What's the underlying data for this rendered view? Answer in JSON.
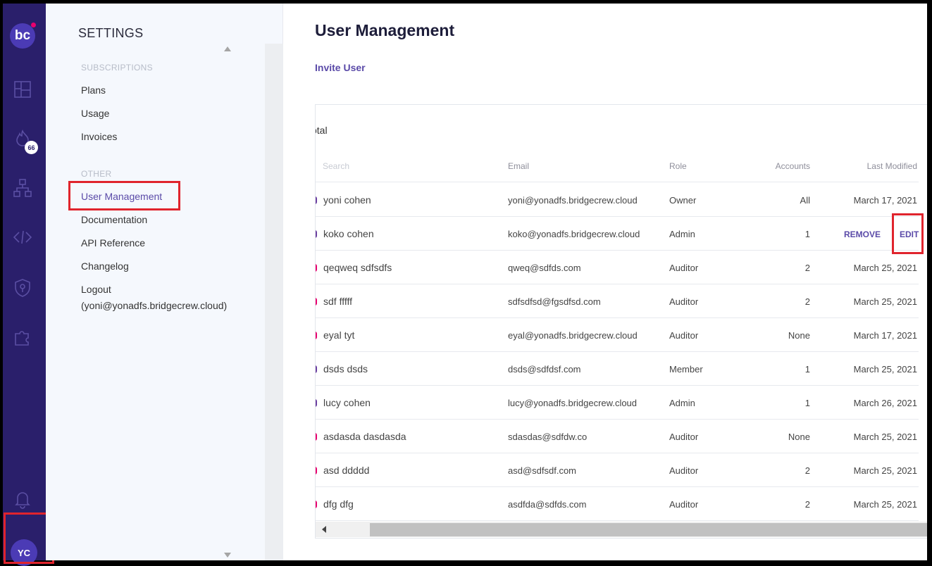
{
  "rail": {
    "logo_text": "bc",
    "badge_count": "66",
    "avatar_initials": "YC",
    "icons": [
      "dashboard-icon",
      "incidents-icon",
      "resources-icon",
      "code-icon",
      "security-icon",
      "integrations-icon",
      "bell-icon"
    ]
  },
  "settings": {
    "title": "SETTINGS",
    "subscriptions_heading": "SUBSCRIPTIONS",
    "plans": "Plans",
    "usage": "Usage",
    "invoices": "Invoices",
    "other_heading": "OTHER",
    "user_management": "User Management",
    "documentation": "Documentation",
    "api_reference": "API Reference",
    "changelog": "Changelog",
    "logout": "Logout",
    "logout_email": "(yoni@yonadfs.bridgecrew.cloud)"
  },
  "main": {
    "title": "User Management",
    "invite_label": "Invite User",
    "total_label": "otal",
    "search_placeholder": "Search",
    "columns": {
      "email": "Email",
      "role": "Role",
      "accounts": "Accounts",
      "last_modified": "Last Modified"
    },
    "row_actions": {
      "remove": "REMOVE",
      "edit": "EDIT"
    },
    "users": [
      {
        "name": "yoni cohen",
        "email": "yoni@yonadfs.bridgecrew.cloud",
        "role": "Owner",
        "accounts": "All",
        "modified": "March 17, 2021",
        "dot": "#6b3fa0"
      },
      {
        "name": "koko cohen",
        "email": "koko@yonadfs.bridgecrew.cloud",
        "role": "Admin",
        "accounts": "1",
        "modified": "",
        "dot": "#6b3fa0"
      },
      {
        "name": "qeqweq sdfsdfs",
        "email": "qweq@sdfds.com",
        "role": "Auditor",
        "accounts": "2",
        "modified": "March 25, 2021",
        "dot": "#e8006f"
      },
      {
        "name": "sdf fffff",
        "email": "sdfsdfsd@fgsdfsd.com",
        "role": "Auditor",
        "accounts": "2",
        "modified": "March 25, 2021",
        "dot": "#e8006f"
      },
      {
        "name": "eyal tyt",
        "email": "eyal@yonadfs.bridgecrew.cloud",
        "role": "Auditor",
        "accounts": "None",
        "modified": "March 17, 2021",
        "dot": "#e8006f"
      },
      {
        "name": "dsds dsds",
        "email": "dsds@sdfdsf.com",
        "role": "Member",
        "accounts": "1",
        "modified": "March 25, 2021",
        "dot": "#6b3fa0"
      },
      {
        "name": "lucy cohen",
        "email": "lucy@yonadfs.bridgecrew.cloud",
        "role": "Admin",
        "accounts": "1",
        "modified": "March 26, 2021",
        "dot": "#6b3fa0"
      },
      {
        "name": "asdasda dasdasda",
        "email": "sdasdas@sdfdw.co",
        "role": "Auditor",
        "accounts": "None",
        "modified": "March 25, 2021",
        "dot": "#e8006f"
      },
      {
        "name": "asd ddddd",
        "email": "asd@sdfsdf.com",
        "role": "Auditor",
        "accounts": "2",
        "modified": "March 25, 2021",
        "dot": "#e8006f"
      },
      {
        "name": "dfg dfg",
        "email": "asdfda@sdfds.com",
        "role": "Auditor",
        "accounts": "2",
        "modified": "March 25, 2021",
        "dot": "#e8006f"
      }
    ]
  },
  "colors": {
    "rail": "#2a1f6b",
    "accent": "#5a4aa8",
    "highlight": "#e0242d"
  }
}
